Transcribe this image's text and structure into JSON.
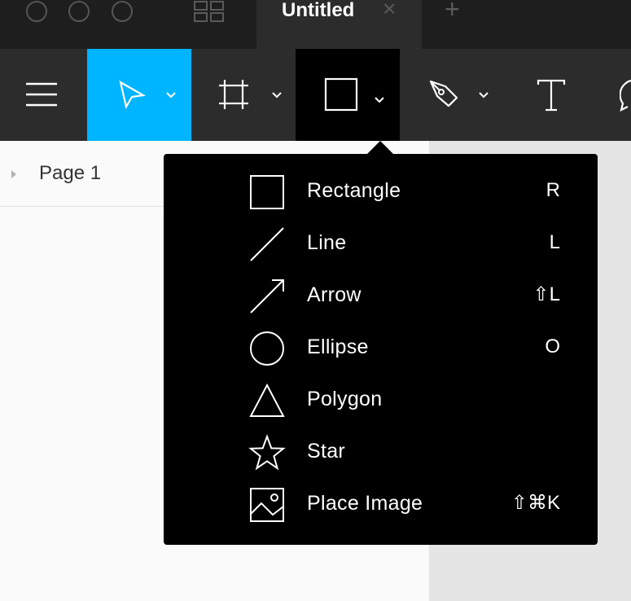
{
  "titlebar": {
    "tab_title": "Untitled",
    "tab_close": "×",
    "tab_add": "+"
  },
  "toolbar": {
    "tools": [
      {
        "name": "menu",
        "icon": "hamburger-icon"
      },
      {
        "name": "move",
        "icon": "cursor-arrow-icon",
        "active": true
      },
      {
        "name": "frame",
        "icon": "frame-icon"
      },
      {
        "name": "shape",
        "icon": "rectangle-icon",
        "open": true
      },
      {
        "name": "pen",
        "icon": "pen-icon"
      },
      {
        "name": "text",
        "icon": "text-icon"
      }
    ],
    "active_color": "#00b5ff"
  },
  "layers": {
    "page_label": "Page 1"
  },
  "shape_menu": {
    "items": [
      {
        "label": "Rectangle",
        "shortcut": "R",
        "icon": "rectangle-icon"
      },
      {
        "label": "Line",
        "shortcut": "L",
        "icon": "line-icon"
      },
      {
        "label": "Arrow",
        "shortcut": "⇧L",
        "icon": "arrow-icon"
      },
      {
        "label": "Ellipse",
        "shortcut": "O",
        "icon": "ellipse-icon"
      },
      {
        "label": "Polygon",
        "shortcut": "",
        "icon": "polygon-icon"
      },
      {
        "label": "Star",
        "shortcut": "",
        "icon": "star-icon"
      },
      {
        "label": "Place Image",
        "shortcut": "⇧⌘K",
        "icon": "image-icon"
      }
    ]
  }
}
